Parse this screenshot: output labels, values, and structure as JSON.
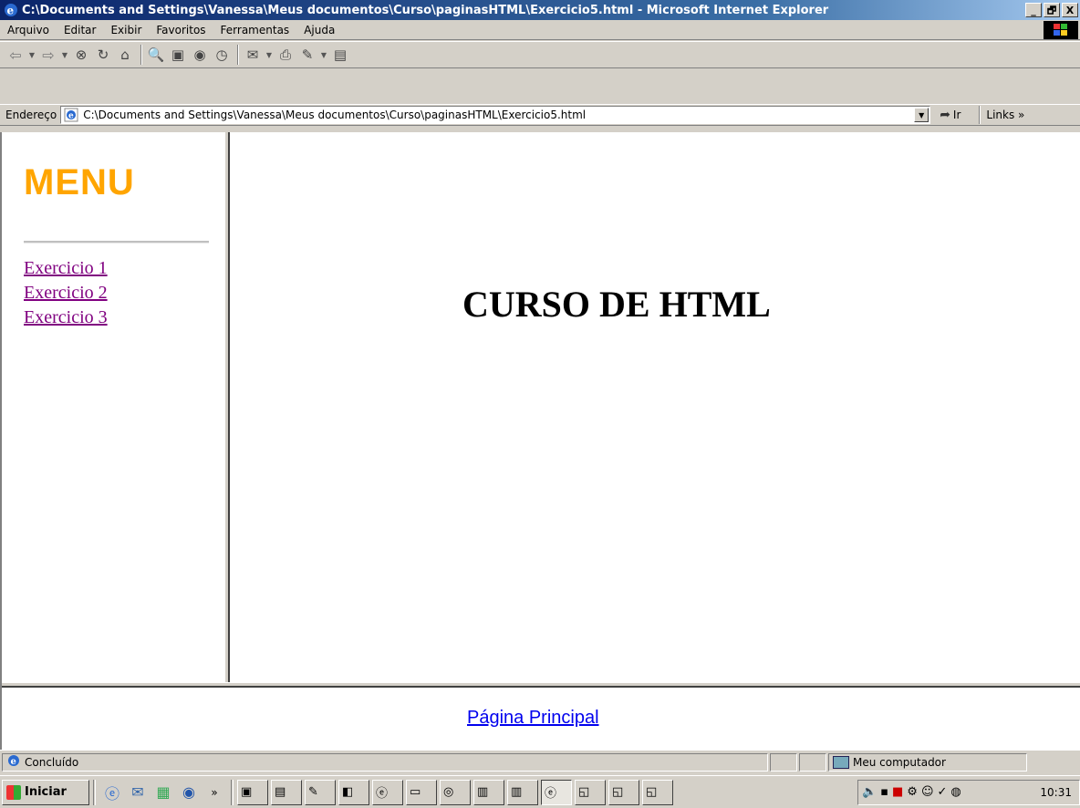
{
  "window": {
    "title": "C:\\Documents and Settings\\Vanessa\\Meus documentos\\Curso\\paginasHTML\\Exercicio5.html - Microsoft Internet Explorer",
    "minimize": "_",
    "maximize": "🗗",
    "close": "X"
  },
  "menubar": {
    "items": [
      "Arquivo",
      "Editar",
      "Exibir",
      "Favoritos",
      "Ferramentas",
      "Ajuda"
    ]
  },
  "addressbar": {
    "label": "Endereço",
    "url": "C:\\Documents and Settings\\Vanessa\\Meus documentos\\Curso\\paginasHTML\\Exercicio5.html",
    "go_label": "Ir",
    "links_label": "Links »"
  },
  "left_frame": {
    "title": "MENU",
    "title_color": "#ffa500",
    "links": [
      "Exercicio 1",
      "Exercicio 2",
      "Exercicio 3"
    ],
    "link_color": "#800080"
  },
  "main_frame": {
    "heading": "CURSO DE HTML"
  },
  "bottom_frame": {
    "link": "Página Principal",
    "link_color": "#0000ee"
  },
  "statusbar": {
    "status": "Concluído",
    "zone": "Meu computador"
  },
  "taskbar": {
    "start_label": "Iniciar",
    "clock": "10:31"
  }
}
